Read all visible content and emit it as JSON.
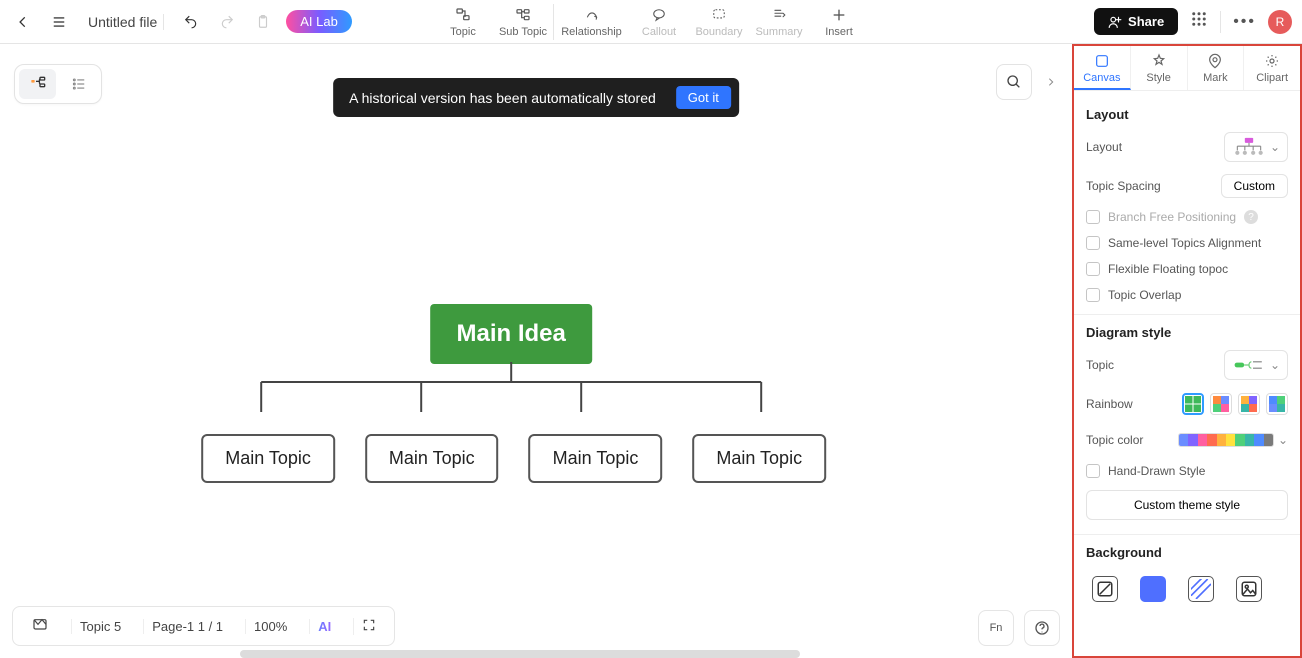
{
  "header": {
    "file_title": "Untitled file",
    "ai_lab": "AI Lab",
    "share": "Share",
    "avatar_initial": "R",
    "tools": [
      {
        "label": "Topic"
      },
      {
        "label": "Sub Topic"
      },
      {
        "label": "Relationship"
      },
      {
        "label": "Callout"
      },
      {
        "label": "Boundary"
      },
      {
        "label": "Summary"
      },
      {
        "label": "Insert"
      }
    ]
  },
  "toast": {
    "message": "A historical version has been automatically stored",
    "action": "Got it"
  },
  "mindmap": {
    "central": "Main Idea",
    "topics": [
      "Main Topic",
      "Main Topic",
      "Main Topic",
      "Main Topic"
    ]
  },
  "status": {
    "topic_count": "Topic 5",
    "page": "Page-1  1 / 1",
    "zoom": "100%",
    "ai": "AI"
  },
  "side": {
    "tabs": [
      "Canvas",
      "Style",
      "Mark",
      "Clipart"
    ],
    "layout_section": "Layout",
    "layout_label": "Layout",
    "spacing_label": "Topic Spacing",
    "spacing_value": "Custom",
    "branch_free": "Branch Free Positioning",
    "same_level": "Same-level Topics Alignment",
    "flexible": "Flexible Floating topoc",
    "overlap": "Topic Overlap",
    "diagram_section": "Diagram style",
    "topic_label": "Topic",
    "rainbow_label": "Rainbow",
    "topic_color_label": "Topic color",
    "hand_drawn": "Hand-Drawn Style",
    "custom_theme": "Custom theme style",
    "background_section": "Background"
  },
  "colors": {
    "topic_palette": [
      "#6b8dff",
      "#8064ff",
      "#ff5fa0",
      "#ff6b4f",
      "#ffb23e",
      "#ffe23e",
      "#4fd07a",
      "#38b6a8",
      "#4f8bff",
      "#7a7a7a"
    ]
  }
}
